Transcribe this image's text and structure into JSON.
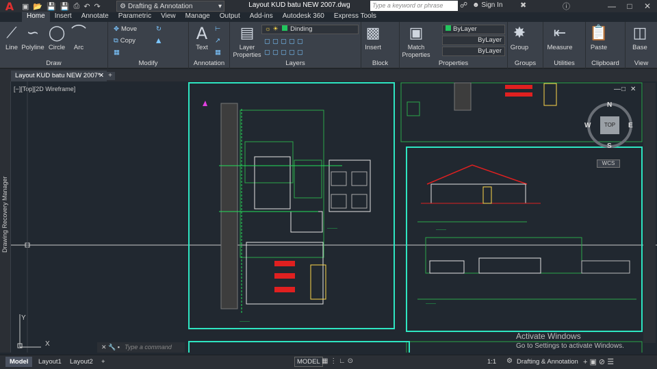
{
  "titlebar": {
    "workspace": "Drafting & Annotation",
    "doc_title": "Layout KUD batu NEW 2007.dwg",
    "search_placeholder": "Type a keyword or phrase",
    "signin": "Sign In"
  },
  "ribbon": {
    "tabs": [
      "Home",
      "Insert",
      "Annotate",
      "Parametric",
      "View",
      "Manage",
      "Output",
      "Add-ins",
      "Autodesk 360",
      "Express Tools"
    ],
    "panels": {
      "draw": {
        "title": "Draw",
        "tools": [
          "Line",
          "Polyline",
          "Circle",
          "Arc"
        ]
      },
      "modify": {
        "title": "Modify",
        "tools": [
          "Move",
          "Copy"
        ]
      },
      "annotation": {
        "title": "Annotation",
        "tools": [
          "Text"
        ]
      },
      "layers": {
        "title": "Layers",
        "layer_properties": "Layer Properties",
        "current_layer": "Dinding"
      },
      "block": {
        "title": "Block",
        "insert": "Insert"
      },
      "properties": {
        "title": "Properties",
        "match": "Match Properties",
        "color": "ByLayer",
        "linetype": "ByLayer",
        "lineweight": "ByLayer"
      },
      "groups": {
        "title": "Groups",
        "group": "Group"
      },
      "utilities": {
        "title": "Utilities",
        "measure": "Measure"
      },
      "clipboard": {
        "title": "Clipboard",
        "paste": "Paste"
      },
      "view": {
        "title": "View",
        "base": "Base"
      }
    }
  },
  "file_tab": {
    "label": "Layout KUD batu NEW 2007*"
  },
  "canvas": {
    "recovery_manager": "Drawing Recovery Manager",
    "viewport_controls": "[−][Top][2D Wireframe]",
    "compass": {
      "n": "N",
      "s": "S",
      "e": "E",
      "w": "W",
      "top": "TOP"
    },
    "wcs": "WCS",
    "command_placeholder": "Type a command",
    "activate_title": "Activate Windows",
    "activate_sub": "Go to Settings to activate Windows."
  },
  "statusbar": {
    "layouts": [
      "Model",
      "Layout1",
      "Layout2"
    ],
    "model_btn": "MODEL",
    "scale": "1:1",
    "workspace": "Drafting & Annotation"
  }
}
